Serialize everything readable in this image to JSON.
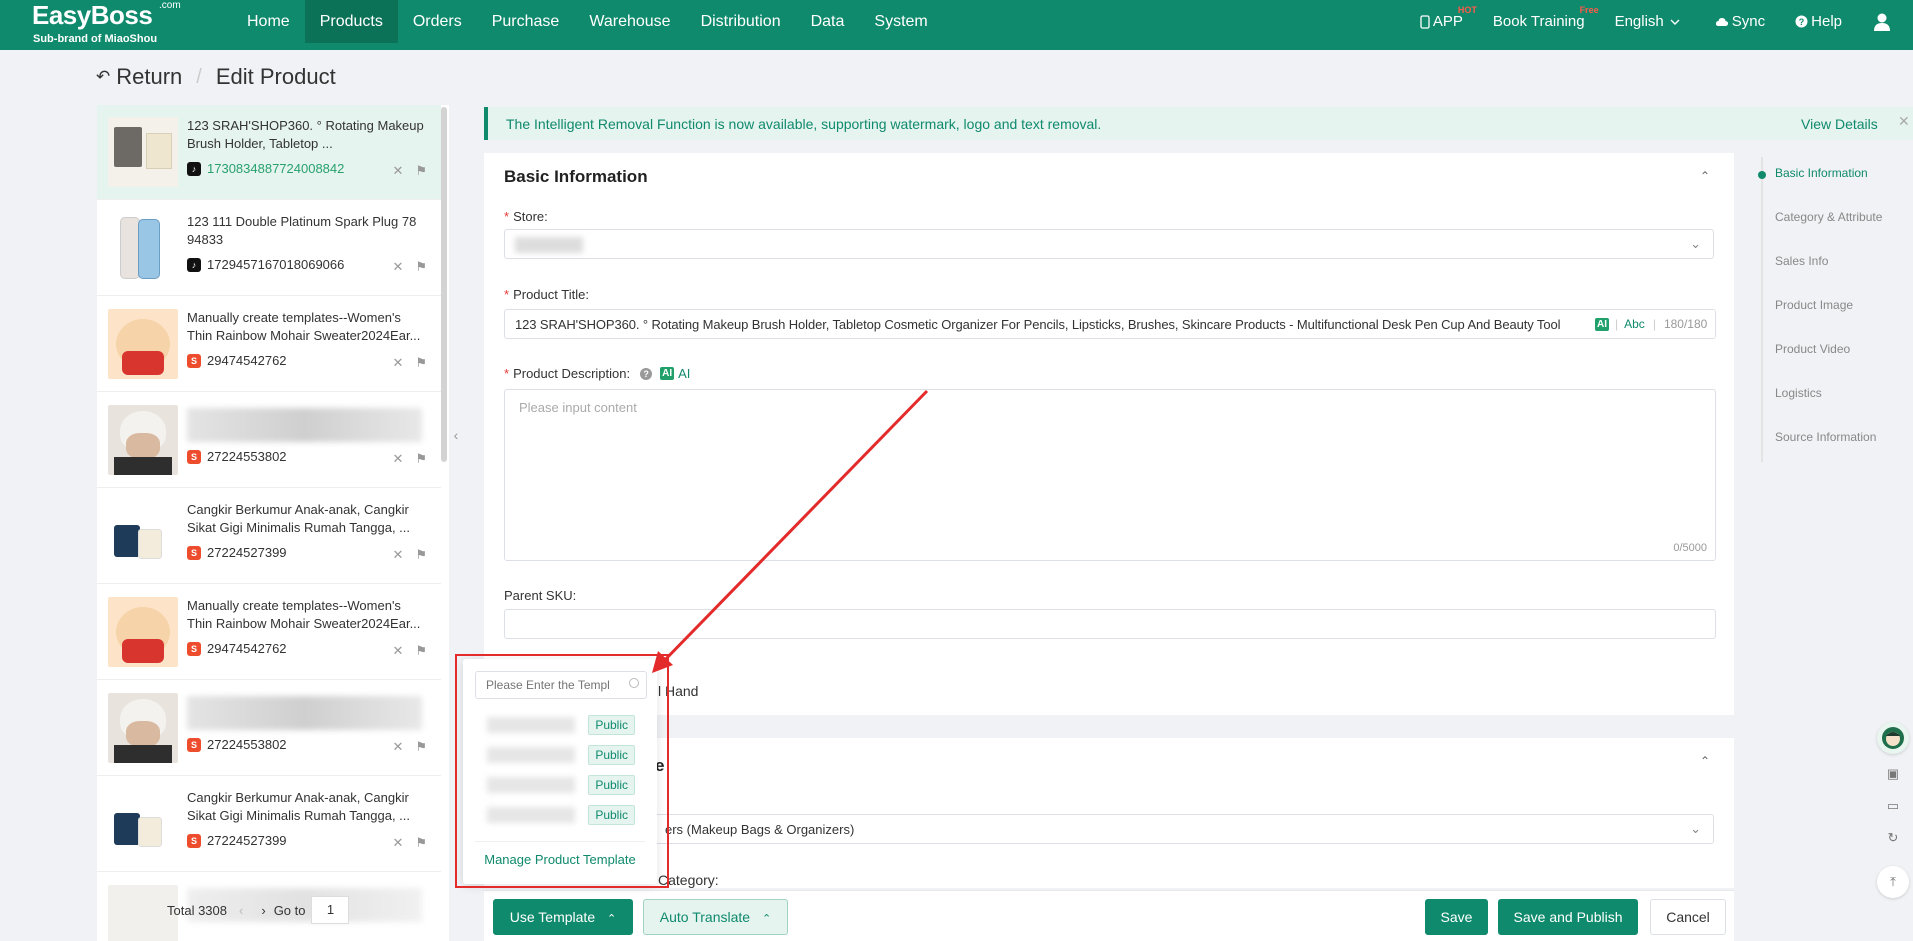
{
  "nav": {
    "brand": "EasyBoss",
    "brand_com": ".com",
    "sub": "Sub-brand of MiaoShou",
    "menu": [
      "Home",
      "Products",
      "Orders",
      "Purchase",
      "Warehouse",
      "Distribution",
      "Data",
      "System"
    ],
    "active_menu": "Products",
    "app": "APP",
    "app_badge": "HOT",
    "book_training": "Book Training",
    "book_badge": "Free",
    "language": "English",
    "sync": "Sync",
    "help": "Help"
  },
  "header": {
    "return": "Return",
    "title": "Edit Product"
  },
  "products": [
    {
      "title": "123 SRAH'SHOP360. ° Rotating Makeup Brush Holder, Tabletop ...",
      "id": "1730834887724008842",
      "platform": "tiktok",
      "selected": true
    },
    {
      "title": "123 111 Double Platinum Spark Plug 78 94833",
      "id": "1729457167018069066",
      "platform": "tiktok"
    },
    {
      "title": "Manually create templates--Women's Thin Rainbow Mohair Sweater2024Ear...",
      "id": "29474542762",
      "platform": "shopee"
    },
    {
      "title": "",
      "id": "27224553802",
      "platform": "shopee",
      "blurred": true
    },
    {
      "title": "Cangkir Berkumur Anak-anak, Cangkir Sikat Gigi Minimalis Rumah Tangga, ...",
      "id": "27224527399",
      "platform": "shopee"
    },
    {
      "title": "Manually create templates--Women's Thin Rainbow Mohair Sweater2024Ear...",
      "id": "29474542762",
      "platform": "shopee"
    },
    {
      "title": "",
      "id": "27224553802",
      "platform": "shopee",
      "blurred": true
    },
    {
      "title": "Cangkir Berkumur Anak-anak, Cangkir Sikat Gigi Minimalis Rumah Tangga, ...",
      "id": "27224527399",
      "platform": "shopee"
    },
    {
      "title": "",
      "id": "",
      "platform": "shopee",
      "blurred": true
    }
  ],
  "pagination": {
    "total": "Total 3308",
    "goto": "Go to",
    "page": "1"
  },
  "notice": {
    "text": "The Intelligent Removal Function is now available, supporting watermark, logo and text removal.",
    "link": "View Details"
  },
  "basic": {
    "title": "Basic Information",
    "store_label": "Store:",
    "title_label": "Product Title:",
    "title_value": "123 SRAH'SHOP360. ° Rotating Makeup Brush Holder, Tabletop Cosmetic Organizer For Pencils, Lipsticks, Brushes, Skincare Products - Multifunctional Desk Pen Cup And Beauty Tool",
    "title_ai": "AI",
    "title_abc": "Abc",
    "title_count": "180/180",
    "desc_label": "Product Description:",
    "desc_ai": "AI",
    "desc_placeholder": "Please input content",
    "desc_count": "0/5000",
    "sku_label": "Parent SKU:",
    "hand_text": "l Hand"
  },
  "category": {
    "title_partial": "e",
    "select_value": "ers (Makeup Bags & Organizers)",
    "category_label_partial": "Category:"
  },
  "anchors": [
    "Basic Information",
    "Category & Attribute",
    "Sales Info",
    "Product Image",
    "Product Video",
    "Logistics",
    "Source Information"
  ],
  "active_anchor": "Basic Information",
  "template_popover": {
    "search_placeholder": "Please Enter the Templ",
    "items": [
      {
        "tag": "Public"
      },
      {
        "tag": "Public"
      },
      {
        "tag": "Public"
      },
      {
        "tag": "Public"
      }
    ],
    "manage": "Manage Product Template"
  },
  "bottom": {
    "use_template": "Use Template",
    "auto_translate": "Auto Translate",
    "save": "Save",
    "save_publish": "Save and Publish",
    "cancel": "Cancel"
  },
  "colors": {
    "brand": "#0f8a6c",
    "annotation": "#e32b2b"
  }
}
